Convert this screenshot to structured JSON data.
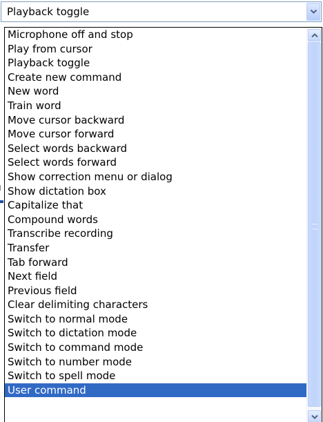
{
  "combo": {
    "selected_value": "Playback toggle",
    "arrow_icon": "chevron-down-icon"
  },
  "dropdown": {
    "items": [
      "Microphone off and stop",
      "Play from cursor",
      "Playback toggle",
      "Create new command",
      "New word",
      "Train word",
      "Move cursor backward",
      "Move cursor forward",
      "Select words backward",
      "Select words forward",
      "Show correction menu or dialog",
      "Show dictation box",
      "Capitalize that",
      "Compound words",
      "Transcribe recording",
      "Transfer",
      "Tab forward",
      "Next field",
      "Previous field",
      "Clear delimiting characters",
      "Switch to normal mode",
      "Switch to dictation mode",
      "Switch to command mode",
      "Switch to number mode",
      "Switch to spell mode",
      "User command"
    ],
    "highlighted_item": "User command"
  },
  "scrollbar": {
    "up_icon": "scroll-up-arrow-icon",
    "down_icon": "scroll-down-arrow-icon"
  },
  "colors": {
    "selection": "#316ac5",
    "border": "#7f9db9",
    "scrollbar_thumb": "#c1d4fb"
  }
}
